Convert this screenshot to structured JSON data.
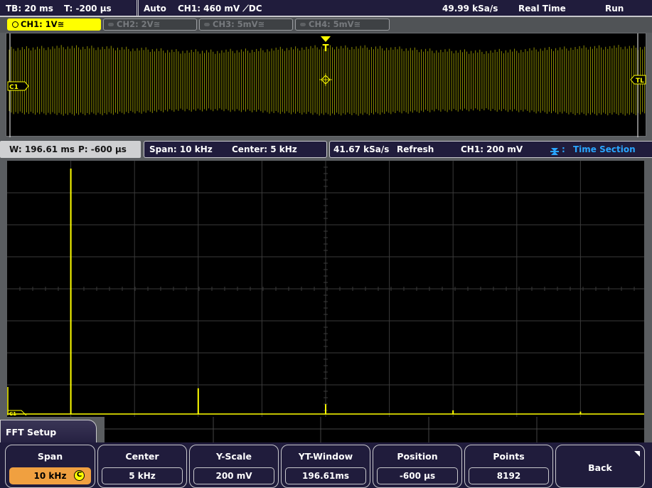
{
  "status_bar": {
    "timebase": "TB: 20 ms",
    "trigger_time": "T: -200 µs",
    "trigger_mode": "Auto",
    "trigger_info": "CH1: 460 mV ⟋DC",
    "sample_rate": "49.99 kSa/s",
    "acq_mode": "Real Time",
    "run_state": "Run"
  },
  "channels": [
    {
      "label": "CH1: 1V≅",
      "active": true
    },
    {
      "label": "CH2: 2V≅",
      "active": false
    },
    {
      "label": "CH3: 5mV≅",
      "active": false
    },
    {
      "label": "CH4: 5mV≅",
      "active": false
    }
  ],
  "yt_window": {
    "trigger_marker": "T",
    "channel_marker": "C1",
    "trigger_level_marker": "TL"
  },
  "info_bar": {
    "window": "W: 196.61 ms",
    "position": "P: -600 µs",
    "span": "Span: 10 kHz",
    "center": "Center: 5 kHz",
    "fft_sample_rate": "41.67 kSa/s",
    "fft_mode": "Refresh",
    "ch_scale": "CH1: 200 mV",
    "cursor_source_sep": ":",
    "cursor_source": "Time Section"
  },
  "fft": {
    "channel_marker": "C1",
    "freq_start_khz": 0,
    "freq_stop_khz": 10,
    "peaks": [
      {
        "freq_khz": 1.0,
        "level": 1.0
      },
      {
        "freq_khz": 3.0,
        "level": 0.105
      },
      {
        "freq_khz": 5.0,
        "level": 0.04
      },
      {
        "freq_khz": 7.0,
        "level": 0.015
      },
      {
        "freq_khz": 9.0,
        "level": 0.01
      }
    ]
  },
  "menu": {
    "title": "FFT Setup",
    "softkeys": [
      {
        "label": "Span",
        "value": "10 kHz",
        "active": true,
        "knob": "C"
      },
      {
        "label": "Center",
        "value": "5 kHz"
      },
      {
        "label": "Y-Scale",
        "value": "200 mV"
      },
      {
        "label": "YT-Window",
        "value": "196.61ms"
      },
      {
        "label": "Position",
        "value": "-600 µs"
      },
      {
        "label": "Points",
        "value": "8192"
      },
      {
        "label": "Back"
      }
    ]
  },
  "colors": {
    "ch1": "#ffff00",
    "bar_bg": "#201c3c",
    "active_softkey": "#f0a040",
    "cursor_source": "#2aa6ff"
  }
}
